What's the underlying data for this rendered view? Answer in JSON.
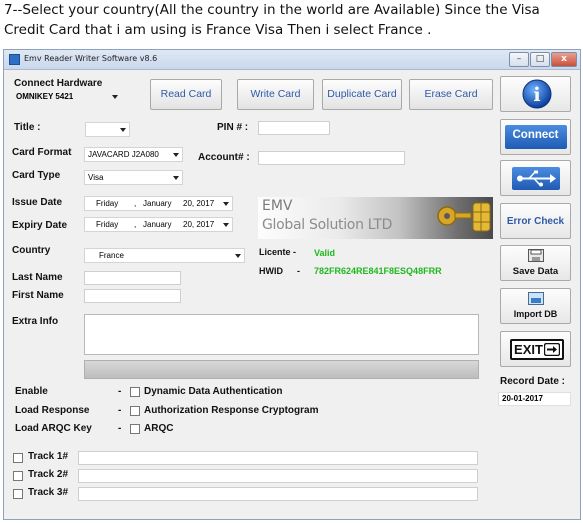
{
  "caption": "7--Select your country(All the country in the world are Available) Since the Visa Credit Card that i am using is France Visa Then i select France .",
  "window": {
    "title": "Emv Reader Writer Software v8.6",
    "close": "x"
  },
  "hardware": {
    "label": "Connect Hardware",
    "value": "OMNIKEY 5421"
  },
  "toolbar": {
    "read": "Read Card",
    "write": "Write Card",
    "duplicate": "Duplicate Card",
    "erase": "Erase Card"
  },
  "form": {
    "title_label": "Title :",
    "title_value": "",
    "pin_label": "PIN # :",
    "pin_value": "",
    "card_format_label": "Card Format",
    "card_format_value": "JAVACARD J2A080",
    "account_label": "Account# :",
    "account_value": "",
    "card_type_label": "Card Type",
    "card_type_value": "Visa",
    "issue_label": "Issue Date",
    "issue_day": "Friday",
    "issue_month": "January",
    "issue_date": "20, 2017",
    "expiry_label": "Expiry Date",
    "expiry_day": "Friday",
    "expiry_month": "January",
    "expiry_date": "20, 2017",
    "date_sep": ",",
    "country_label": "Country",
    "country_value": "France",
    "last_name_label": "Last Name",
    "first_name_label": "First Name",
    "extra_label": "Extra Info"
  },
  "brand": {
    "line1": "EMV",
    "line2": "Global Solution LTD"
  },
  "license": {
    "label": "Licente -",
    "value": "Valid",
    "hwid_label": "HWID",
    "hwid_dash": "-",
    "hwid_value": "782FR624RE841F8ESQ48FRR"
  },
  "options": {
    "enable_label": "Enable",
    "enable_text": "Dynamic Data Authentication",
    "load_response_label": "Load Response",
    "load_response_text": "Authorization Response Cryptogram",
    "load_arqc_label": "Load ARQC Key",
    "load_arqc_text": "ARQC",
    "dash": "-"
  },
  "tracks": {
    "track1": "Track 1#",
    "track2": "Track 2#",
    "track3": "Track 3#"
  },
  "sidebar": {
    "info_glyph": "i",
    "connect": "Connect",
    "error_check": "Error Check",
    "save_data": "Save Data",
    "import_db": "Import DB",
    "exit": "EXIT"
  },
  "record": {
    "label": "Record Date :",
    "value": "20-01-2017"
  },
  "colors": {
    "accent": "#2f5aa8",
    "valid": "#1eb81e",
    "connect_bg": "#2c6bc4"
  }
}
